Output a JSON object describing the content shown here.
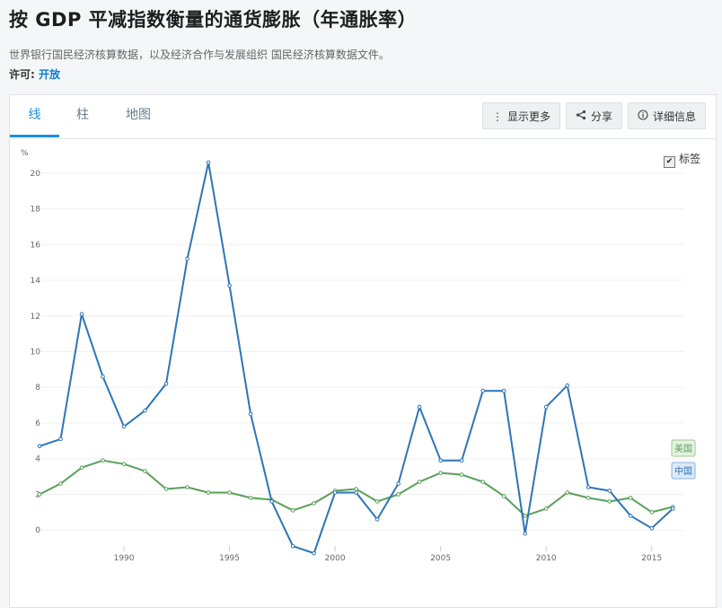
{
  "header": {
    "title": "按 GDP 平减指数衡量的通货膨胀（年通胀率）",
    "source": "世界银行国民经济核算数据，以及经济合作与发展组织 国民经济核算数据文件。",
    "license_label": "许可:",
    "license_value": "开放"
  },
  "tabs": [
    {
      "label": "线",
      "active": true
    },
    {
      "label": "柱",
      "active": false
    },
    {
      "label": "地图",
      "active": false
    }
  ],
  "toolbar": {
    "show_more": "显示更多",
    "share": "分享",
    "details": "详细信息"
  },
  "labels_toggle": {
    "label": "标签",
    "checked": true
  },
  "chart_data": {
    "type": "line",
    "ylabel": "%",
    "ylim": [
      -1.5,
      21.5
    ],
    "yticks": [
      0,
      2,
      4,
      6,
      8,
      10,
      12,
      14,
      16,
      18,
      20
    ],
    "xlim": [
      1986,
      2016.5
    ],
    "xticks": [
      1990,
      1995,
      2000,
      2005,
      2010,
      2015
    ],
    "grid": true,
    "legend": "end-of-line labels",
    "x": [
      1986,
      1987,
      1988,
      1989,
      1990,
      1991,
      1992,
      1993,
      1994,
      1995,
      1996,
      1997,
      1998,
      1999,
      2000,
      2001,
      2002,
      2003,
      2004,
      2005,
      2006,
      2007,
      2008,
      2009,
      2010,
      2011,
      2012,
      2013,
      2014,
      2015,
      2016
    ],
    "series": [
      {
        "name": "中国",
        "color": "#2e75b6",
        "values": [
          4.7,
          5.1,
          12.1,
          8.6,
          5.8,
          6.7,
          8.2,
          15.2,
          20.6,
          13.7,
          6.5,
          1.6,
          -0.9,
          -1.3,
          2.1,
          2.1,
          0.6,
          2.6,
          6.9,
          3.9,
          3.9,
          7.8,
          7.8,
          -0.2,
          6.9,
          8.1,
          2.4,
          2.2,
          0.8,
          0.1,
          1.2
        ]
      },
      {
        "name": "美国",
        "color": "#5aa05a",
        "values": [
          2.0,
          2.6,
          3.5,
          3.9,
          3.7,
          3.3,
          2.3,
          2.4,
          2.1,
          2.1,
          1.8,
          1.7,
          1.1,
          1.5,
          2.2,
          2.3,
          1.6,
          2.0,
          2.7,
          3.2,
          3.1,
          2.7,
          1.9,
          0.8,
          1.2,
          2.1,
          1.8,
          1.6,
          1.8,
          1.0,
          1.3
        ]
      }
    ]
  }
}
